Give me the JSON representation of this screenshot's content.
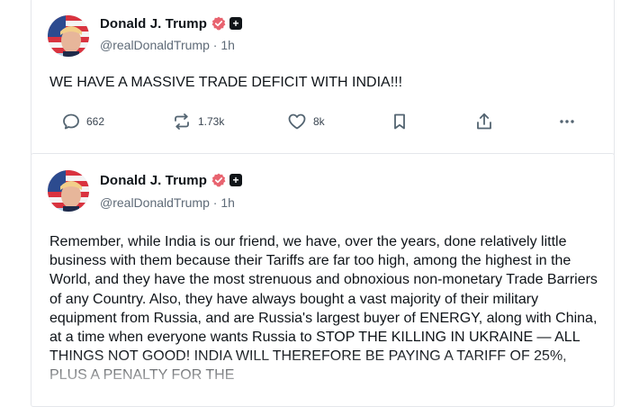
{
  "posts": [
    {
      "author": {
        "display_name": "Donald J. Trump",
        "handle": "@realDonaldTrump",
        "time": "1h",
        "plus_badge": "+"
      },
      "text": "WE HAVE A MASSIVE TRADE DEFICIT WITH INDIA!!!",
      "actions": {
        "replies": "662",
        "retruths": "1.73k",
        "likes": "8k"
      }
    },
    {
      "author": {
        "display_name": "Donald J. Trump",
        "handle": "@realDonaldTrump",
        "time": "1h",
        "plus_badge": "+"
      },
      "text": "Remember, while India is our friend, we have, over the years, done relatively little business with them because their Tariffs are far too high, among the highest in the World, and they have the most strenuous and obnoxious non-monetary Trade Barriers of any Country. Also, they have always bought a vast majority of their military equipment from Russia, and are Russia's largest buyer of ENERGY, along with China, at a time when everyone wants Russia to STOP THE KILLING IN UKRAINE — ALL THINGS NOT GOOD! INDIA WILL THEREFORE BE PAYING A TARIFF OF 25%, PLUS A PENALTY FOR THE"
    }
  ],
  "separator": " · ",
  "colors": {
    "verified_badge": "#e8636f",
    "text_primary": "#0f1419",
    "text_secondary": "#5f6b78",
    "icon": "#536471"
  },
  "icons": {
    "reply": "speech-bubble-icon",
    "retruth": "repost-arrows-icon",
    "like": "heart-icon",
    "bookmark": "bookmark-icon",
    "share": "share-upload-icon",
    "more": "ellipsis-icon"
  }
}
